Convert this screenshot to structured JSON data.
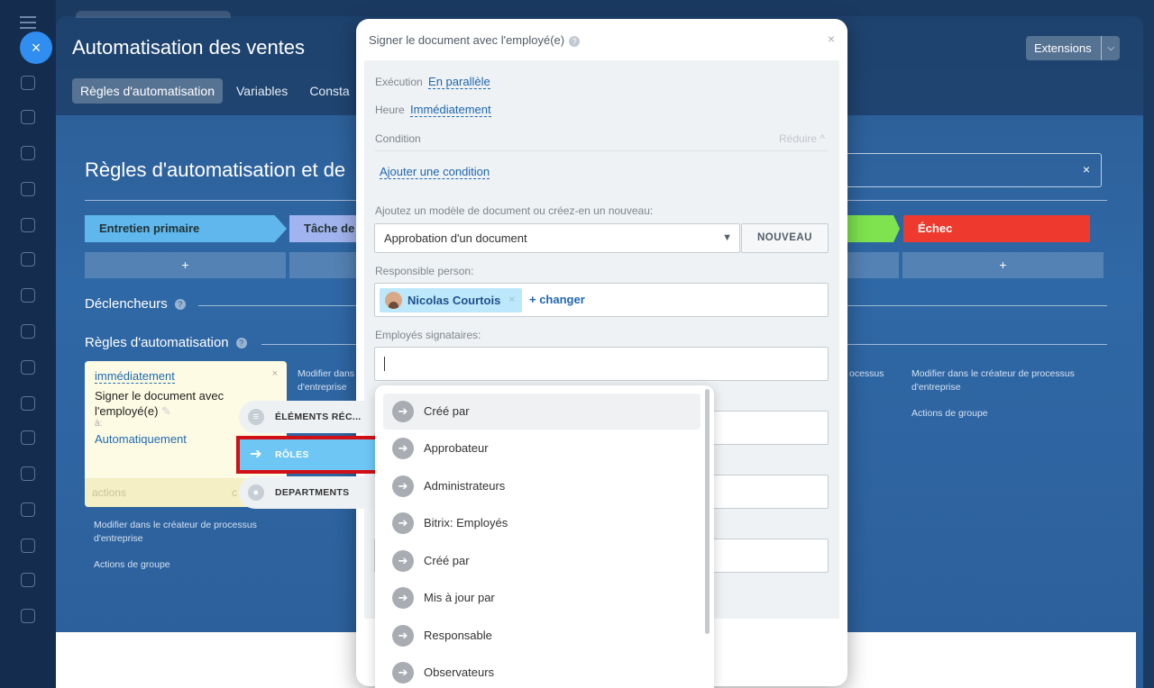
{
  "app": {
    "title": "Automatisation des ventes",
    "tabs": [
      {
        "label": "Règles d'automatisation",
        "active": true
      },
      {
        "label": "Variables",
        "active": false
      },
      {
        "label": "Consta",
        "active": false
      }
    ],
    "extensions_label": "Extensions",
    "close_symbol": "×"
  },
  "main": {
    "heading": "Règles d'automatisation et de",
    "search_clear": "×",
    "stages": [
      {
        "label": "Entretien primaire",
        "color": "#5fb7ee"
      },
      {
        "label": "Tâche de",
        "color": "#a2b4ef"
      },
      {
        "label": "",
        "color": "#7ee34e"
      },
      {
        "label": "Échec",
        "color": "#ee3a2e"
      }
    ],
    "plus": "+",
    "triggers_label": "Déclencheurs",
    "rules_label": "Règles d'automatisation",
    "help": "?",
    "rule_card": {
      "when": "immédiatement",
      "close": "×",
      "name": "Signer le document avec l'employé(e)",
      "to_label": "à:",
      "to_value": "Automatiquement",
      "footer_actions": "actions",
      "footer_c": "c"
    },
    "links": {
      "modify_short": "Modifier dans d'entreprise",
      "modify_full": "Modifier dans le créateur de processus d'entreprise",
      "group_actions": "Actions de groupe",
      "processus_fragment": "ocessus"
    }
  },
  "left_menu": {
    "items": [
      {
        "label": "ÉLÉMENTS RÉC...",
        "icon": "list-icon",
        "active": false
      },
      {
        "label": "RÔLES",
        "icon": "arrow-right-icon",
        "active": true
      },
      {
        "label": "DEPARTMENTS",
        "icon": "group-icon",
        "active": false
      }
    ]
  },
  "modal": {
    "title": "Signer le document avec l'employé(e)",
    "help": "?",
    "close": "×",
    "execution_label": "Exécution",
    "execution_value": "En parallèle",
    "time_label": "Heure",
    "time_value": "Immédiatement",
    "condition_label": "Condition",
    "reduce_label": "Réduire ^",
    "add_condition": "Ajouter une condition",
    "template_label": "Ajoutez un modèle de document ou créez-en un nouveau:",
    "template_value": "Approbation d'un document",
    "new_button": "NOUVEAU",
    "responsible_label": "Responsible person:",
    "responsible_chip": "Nicolas Courtois",
    "chip_remove": "×",
    "change_link": "+ changer",
    "signers_label": "Employés signataires:"
  },
  "dropdown": {
    "items": [
      "Créé par",
      "Approbateur",
      "Administrateurs",
      "Bitrix: Employés",
      "Créé par",
      "Mis à jour par",
      "Responsable",
      "Observateurs"
    ]
  }
}
